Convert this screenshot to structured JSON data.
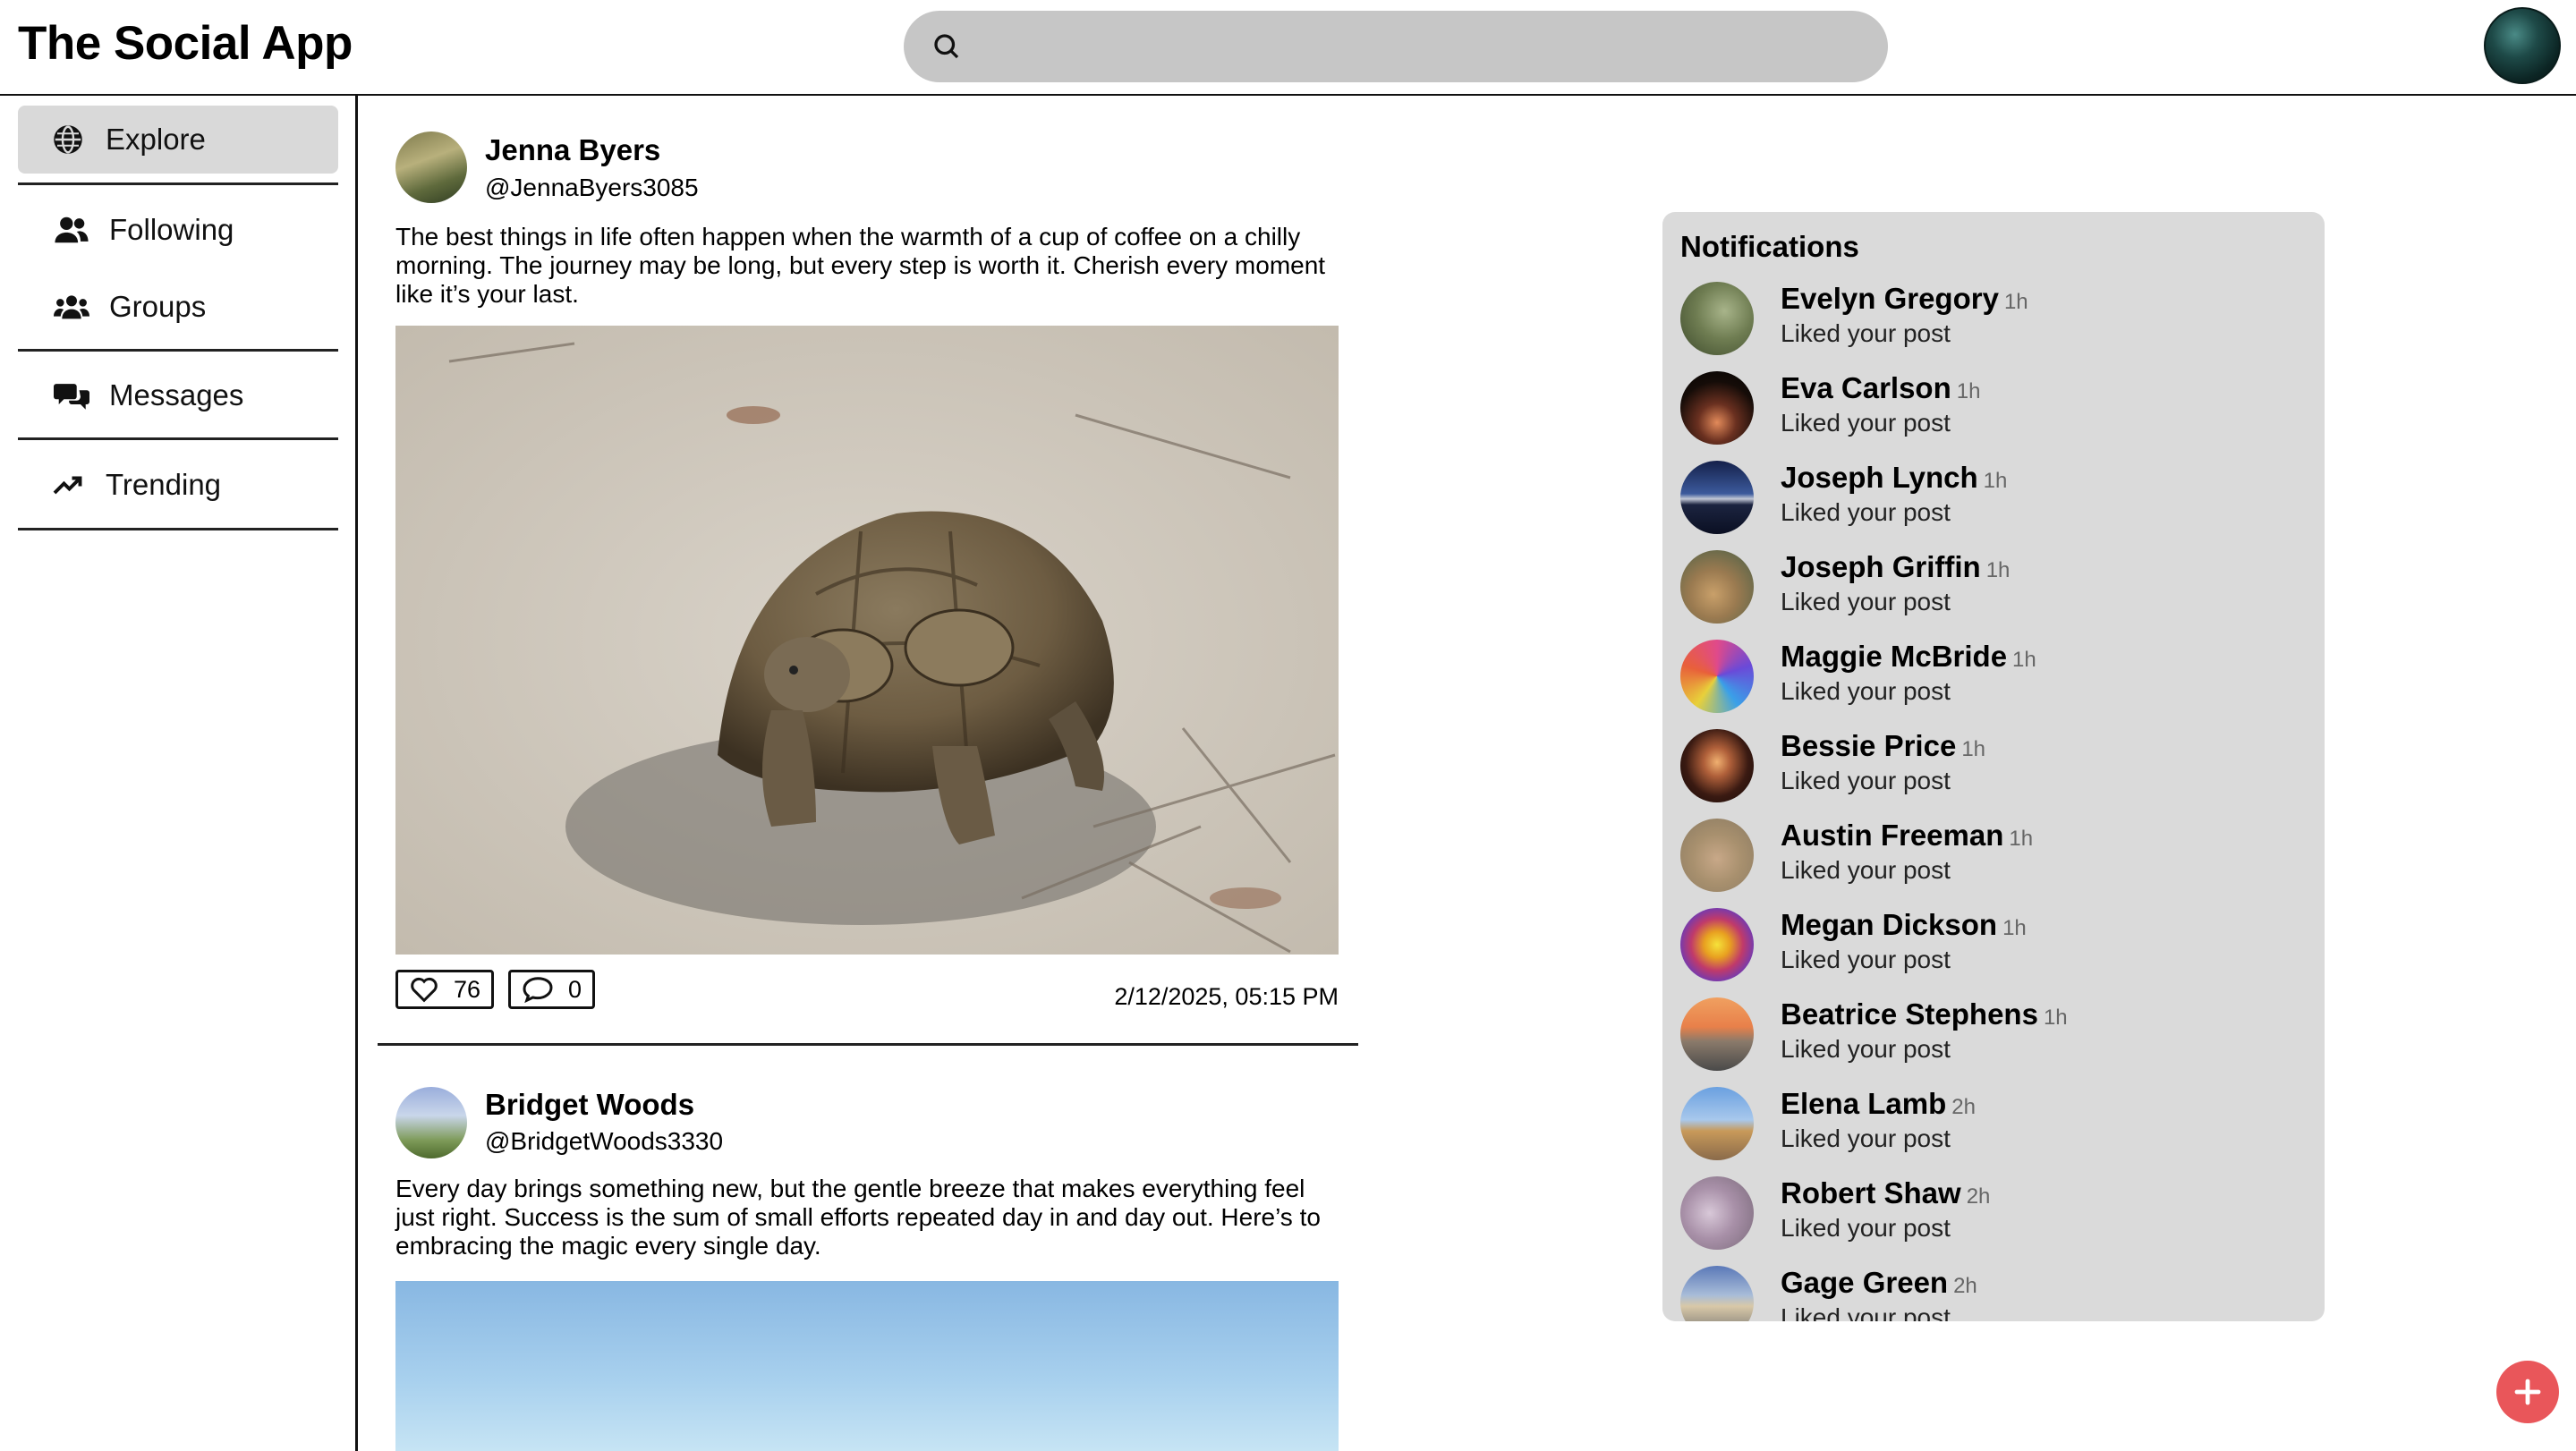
{
  "app": {
    "title": "The Social App"
  },
  "search": {
    "placeholder": "",
    "value": ""
  },
  "sidebar": {
    "items": [
      {
        "label": "Explore",
        "icon": "globe-icon",
        "active": true
      },
      {
        "label": "Following",
        "icon": "users-icon",
        "active": false
      },
      {
        "label": "Groups",
        "icon": "groups-icon",
        "active": false
      },
      {
        "label": "Messages",
        "icon": "messages-icon",
        "active": false
      },
      {
        "label": "Trending",
        "icon": "trending-icon",
        "active": false
      }
    ]
  },
  "feed": {
    "posts": [
      {
        "author": "Jenna Byers",
        "handle": "@JennaByers3085",
        "text": "The best things in life often happen when the warmth of a cup of coffee on a chilly morning. The journey may be long, but every step is worth it. Cherish every moment like it’s your last.",
        "likes": "76",
        "comments": "0",
        "timestamp": "2/12/2025, 05:15 PM"
      },
      {
        "author": "Bridget Woods",
        "handle": "@BridgetWoods3330",
        "text": "Every day brings something new, but the gentle breeze that makes everything feel just right. Success is the sum of small efforts repeated day in and day out. Here’s to embracing the magic every single day."
      }
    ]
  },
  "notifications": {
    "title": "Notifications",
    "items": [
      {
        "name": "Evelyn Gregory",
        "time": "1h",
        "action": "Liked your post"
      },
      {
        "name": "Eva Carlson",
        "time": "1h",
        "action": "Liked your post"
      },
      {
        "name": "Joseph Lynch",
        "time": "1h",
        "action": "Liked your post"
      },
      {
        "name": "Joseph Griffin",
        "time": "1h",
        "action": "Liked your post"
      },
      {
        "name": "Maggie McBride",
        "time": "1h",
        "action": "Liked your post"
      },
      {
        "name": "Bessie Price",
        "time": "1h",
        "action": "Liked your post"
      },
      {
        "name": "Austin Freeman",
        "time": "1h",
        "action": "Liked your post"
      },
      {
        "name": "Megan Dickson",
        "time": "1h",
        "action": "Liked your post"
      },
      {
        "name": "Beatrice Stephens",
        "time": "1h",
        "action": "Liked your post"
      },
      {
        "name": "Elena Lamb",
        "time": "2h",
        "action": "Liked your post"
      },
      {
        "name": "Robert Shaw",
        "time": "2h",
        "action": "Liked your post"
      },
      {
        "name": "Gage Green",
        "time": "2h",
        "action": "Liked your post"
      }
    ]
  },
  "colors": {
    "accent": "#e9565a",
    "panel": "#dadada",
    "active_nav": "#d9d9d9",
    "search_bg": "#c6c6c6"
  }
}
